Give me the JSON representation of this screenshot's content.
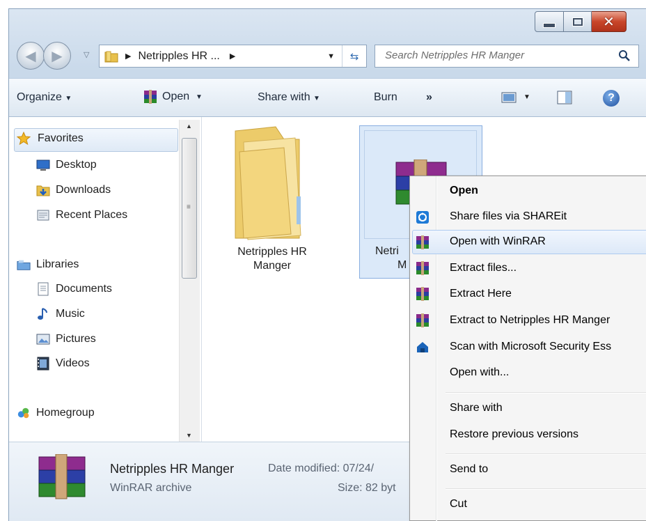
{
  "window": {
    "address_segment": "Netripples HR ...",
    "search_placeholder": "Search Netripples HR Manger"
  },
  "toolbar": {
    "organize": "Organize",
    "open": "Open",
    "share_with": "Share with",
    "burn": "Burn",
    "more": "»"
  },
  "sidebar": {
    "favorites": "Favorites",
    "desktop": "Desktop",
    "downloads": "Downloads",
    "recent_places": "Recent Places",
    "libraries": "Libraries",
    "documents": "Documents",
    "music": "Music",
    "pictures": "Pictures",
    "videos": "Videos",
    "homegroup": "Homegroup"
  },
  "content": {
    "folder_label_1": "Netripples HR",
    "folder_label_2": "Manger",
    "archive_label_1": "Netri",
    "archive_label_2": "M"
  },
  "details": {
    "name": "Netripples HR Manger",
    "type": "WinRAR archive",
    "date_label": "Date modified: 07/24/",
    "size_label": "Size: 82 byt"
  },
  "context_menu": {
    "open": "Open",
    "shareit": "Share files via SHAREit",
    "open_winrar": "Open with WinRAR",
    "extract_files": "Extract files...",
    "extract_here": "Extract Here",
    "extract_to": "Extract to Netripples HR Manger",
    "scan": "Scan with Microsoft Security Ess",
    "open_with": "Open with...",
    "share_with": "Share with",
    "restore": "Restore previous versions",
    "send_to": "Send to",
    "cut": "Cut"
  },
  "colors": {
    "selection": "#dbe9f9",
    "menu_bg": "#f5f5f5",
    "close_red": "#c9462a"
  }
}
